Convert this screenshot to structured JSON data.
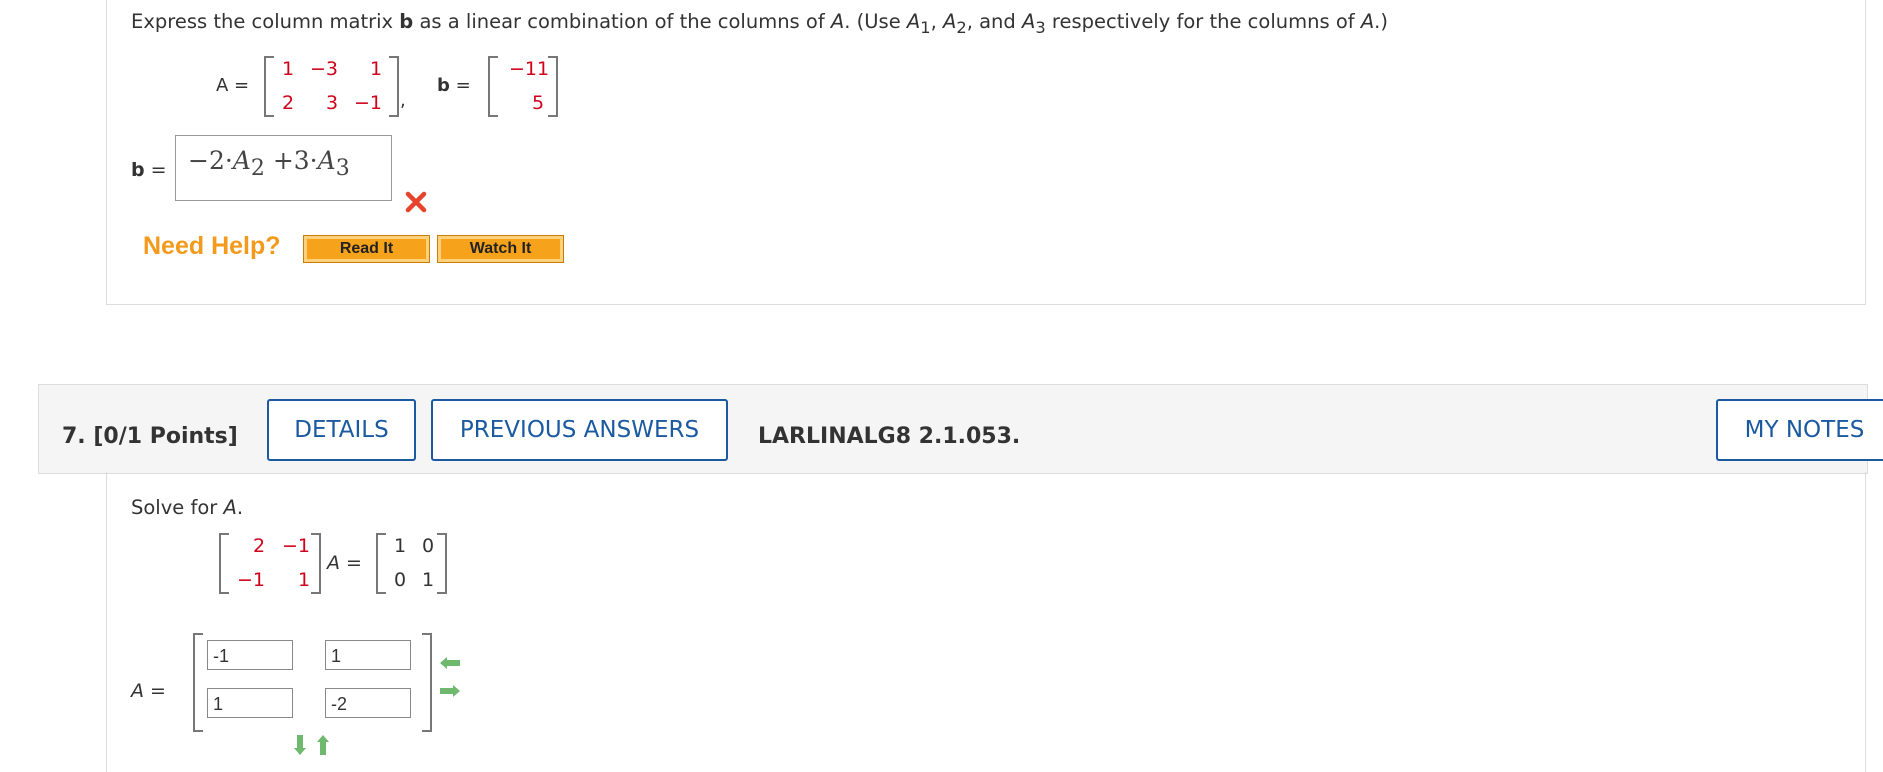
{
  "q6": {
    "prompt_text": "Express the column matrix b as a linear combination of the columns of A. (Use A",
    "prompt_pre": "Express the column matrix ",
    "prompt_b": "b",
    "prompt_mid": " as a linear combination of the columns of ",
    "prompt_A": "A",
    "prompt_use": ". (Use ",
    "prompt_a1": "A",
    "prompt_s1": "1",
    "prompt_comma1": ", ",
    "prompt_a2": "A",
    "prompt_s2": "2",
    "prompt_and": ", and ",
    "prompt_a3": "A",
    "prompt_s3": "3",
    "prompt_tail": " respectively for the columns of ",
    "prompt_A2": "A",
    "prompt_end": ".)",
    "matrix_A_label": "A =",
    "matrix_A": [
      [
        "1",
        "−3",
        "1"
      ],
      [
        "2",
        "3",
        "−1"
      ]
    ],
    "matrix_b_label": "b =",
    "matrix_b": [
      "−11",
      "5"
    ],
    "answer_label": "b =",
    "answer_text": "−2·A₂ +3·A₃",
    "answer_p1": "−2·",
    "answer_a2": "A",
    "answer_s2": "2",
    "answer_p2": " +3·",
    "answer_a3": "A",
    "answer_s3": "3",
    "status_icon": "incorrect-x",
    "need_help": "Need Help?",
    "read_it": "Read It",
    "watch_it": "Watch It",
    "colors": {
      "orange": "#f39a1c",
      "red": "#d0021b",
      "blue": "#1b5aa0",
      "green": "#5cb85c"
    }
  },
  "q7": {
    "number": "7.",
    "points": "[0/1 Points]",
    "details": "DETAILS",
    "previous_answers": "PREVIOUS ANSWERS",
    "code": "LARLINALG8 2.1.053.",
    "my_notes": "MY NOTES",
    "prompt_pre": "Solve for ",
    "prompt_A": "A",
    "prompt_end": ".",
    "lhs_matrix": [
      [
        "2",
        "−1"
      ],
      [
        "−1",
        "1"
      ]
    ],
    "eq_A": "A",
    "eq_sign": "=",
    "rhs_matrix": [
      [
        "1",
        "0"
      ],
      [
        "0",
        "1"
      ]
    ],
    "answer_label_A": "A",
    "answer_label_eq": "=",
    "inputs": [
      [
        "-1",
        "1"
      ],
      [
        "1",
        "-2"
      ]
    ]
  }
}
